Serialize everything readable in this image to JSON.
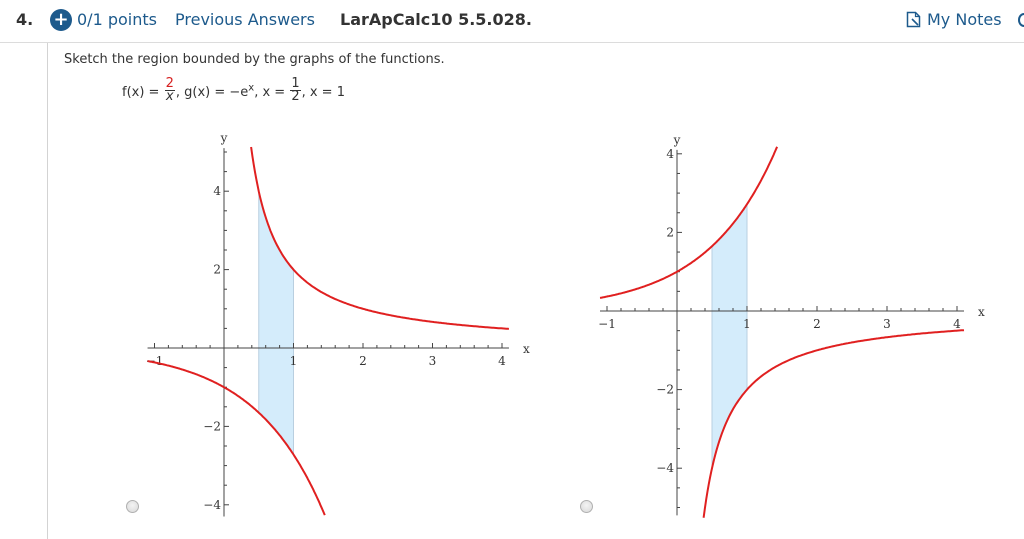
{
  "header": {
    "question_number": "4.",
    "expand_icon": "plus-circle-icon",
    "points": "0/1 points",
    "previous_answers": "Previous Answers",
    "problem_code": "LarApCalc10 5.5.028.",
    "notes_icon": "notes-icon",
    "my_notes": "My Notes"
  },
  "question": {
    "prompt": "Sketch the region bounded by the graphs of the functions.",
    "formula": {
      "f_lhs": "f(x) = ",
      "f_num": "2",
      "f_den": "x",
      "g_part": ", g(x) = −e",
      "g_exp": "x",
      "x1_lhs": ", x = ",
      "x1_num": "1",
      "x1_den": "2",
      "x2": ", x = 1"
    }
  },
  "colors": {
    "link": "#1d5a8c",
    "curve": "#e02020",
    "fill": "#d4ecfb",
    "axis": "#444444"
  },
  "chart_data": [
    {
      "type": "line",
      "option": "A",
      "xlabel": "x",
      "ylabel": "y",
      "xlim": [
        -1.1,
        4.1
      ],
      "ylim": [
        -4.3,
        5.1
      ],
      "x_ticks": [
        -1,
        1,
        2,
        3,
        4
      ],
      "x_tick_labels": [
        "−1",
        "1",
        "2",
        "3",
        "4"
      ],
      "y_ticks": [
        4,
        2,
        -2,
        -4
      ],
      "y_tick_labels": [
        "4",
        "2",
        "−2",
        "−4"
      ],
      "minor_tick_step": 0.2,
      "series": [
        {
          "name": "2/x",
          "expr": "2/x",
          "domain": [
            0.39,
            4.1
          ]
        },
        {
          "name": "-e^x",
          "expr": "-exp(x)",
          "domain": [
            -1.1,
            1.45
          ]
        }
      ],
      "shaded_region": {
        "x_from": 0.5,
        "x_to": 1,
        "upper": "2/x",
        "lower": "-exp(x)"
      }
    },
    {
      "type": "line",
      "option": "B",
      "xlabel": "x",
      "ylabel": "y",
      "xlim": [
        -1.1,
        4.1
      ],
      "ylim": [
        -5.2,
        4.1
      ],
      "x_ticks": [
        -1,
        1,
        2,
        3,
        4
      ],
      "x_tick_labels": [
        "−1",
        "1",
        "2",
        "3",
        "4"
      ],
      "y_ticks": [
        4,
        2,
        -2,
        -4
      ],
      "y_tick_labels": [
        "4",
        "2",
        "−2",
        "−4"
      ],
      "minor_tick_step": 0.2,
      "series": [
        {
          "name": "e^x",
          "expr": "exp(x)",
          "domain": [
            -1.1,
            1.43
          ]
        },
        {
          "name": "-2/x",
          "expr": "-2/x",
          "domain": [
            0.38,
            4.1
          ]
        }
      ],
      "shaded_region": {
        "x_from": 0.5,
        "x_to": 1,
        "upper": "exp(x)",
        "lower": "-2/x"
      }
    }
  ],
  "answers": [
    {
      "label": "option-a",
      "selected": false
    },
    {
      "label": "option-b",
      "selected": false
    }
  ]
}
